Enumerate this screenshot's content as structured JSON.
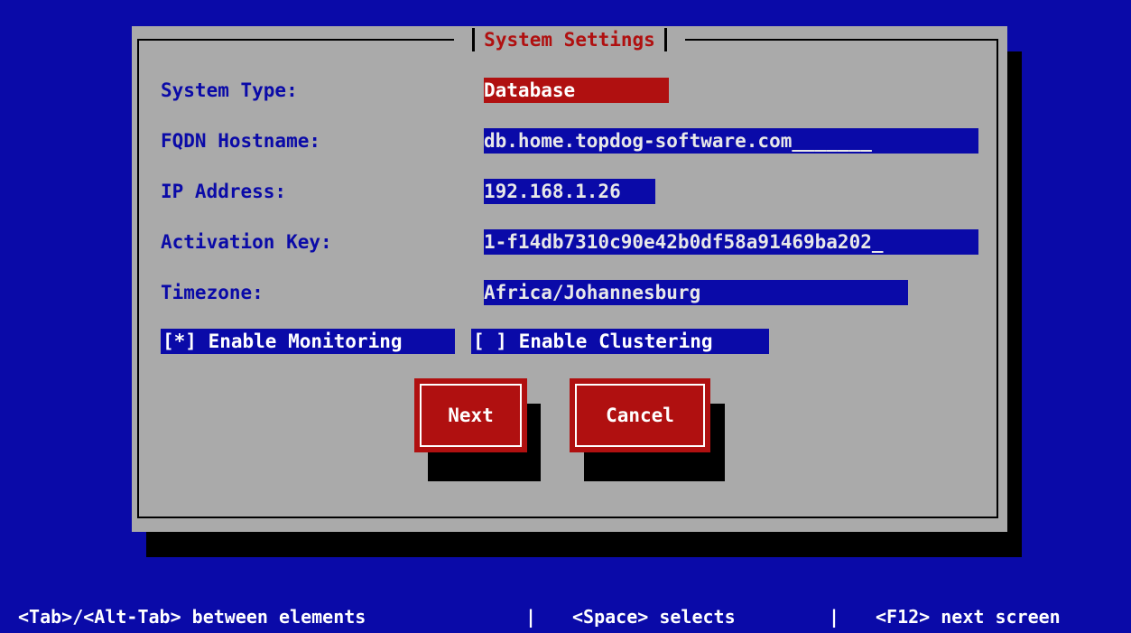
{
  "dialog": {
    "title": "System Settings",
    "fields": [
      {
        "label": "System Type:",
        "value": "Database"
      },
      {
        "label": "FQDN Hostname:",
        "value": "db.home.topdog-software.com_______"
      },
      {
        "label": "IP Address:",
        "value": "192.168.1.26"
      },
      {
        "label": "Activation Key:",
        "value": "1-f14db7310c90e42b0df58a91469ba202_"
      },
      {
        "label": "Timezone:",
        "value": "Africa/Johannesburg"
      }
    ],
    "checkboxes": [
      {
        "label": "[*] Enable Monitoring"
      },
      {
        "label": "[ ] Enable Clustering"
      }
    ],
    "buttons": {
      "next": "Next",
      "cancel": "Cancel"
    }
  },
  "status_bar": {
    "part1": "<Tab>/<Alt-Tab> between elements",
    "sep1": "|",
    "part2": "<Space> selects",
    "sep2": "|",
    "part3": "<F12> next screen"
  },
  "colors": {
    "background": "#0a0aa8",
    "dialog": "#aaaaaa",
    "accent": "#b01010"
  }
}
